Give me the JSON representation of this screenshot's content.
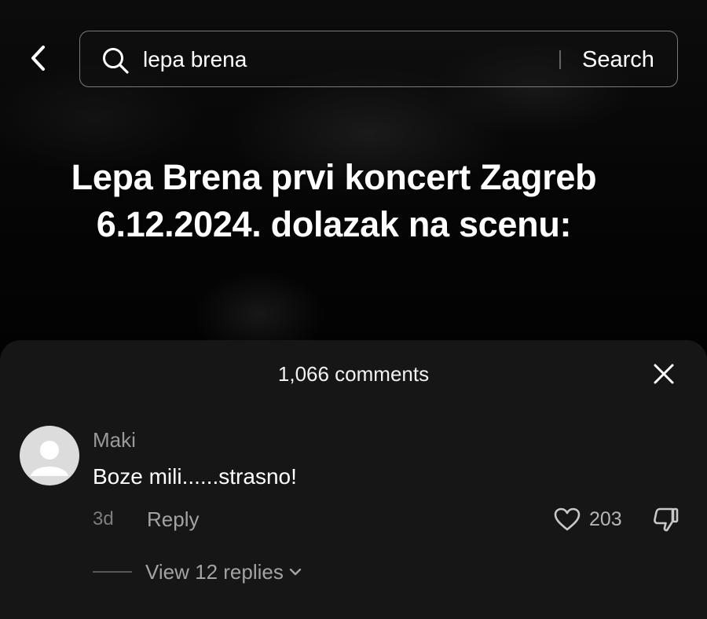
{
  "header": {
    "search": {
      "value": "lepa brena",
      "button_label": "Search"
    }
  },
  "video": {
    "caption_line1": "Lepa Brena prvi koncert Zagreb",
    "caption_line2": "6.12.2024. dolazak na scenu:"
  },
  "comments": {
    "count_label": "1,066 comments",
    "items": [
      {
        "username": "Maki",
        "text": "Boze mili......strasno!",
        "time": "3d",
        "reply_label": "Reply",
        "likes": "203",
        "view_replies_label": "View 12 replies"
      }
    ]
  },
  "icons": {
    "back": "chevron-left-icon",
    "search": "search-icon",
    "close": "close-icon",
    "like": "heart-icon",
    "dislike": "thumbs-down-icon",
    "expand": "chevron-down-icon",
    "avatar": "default-avatar-icon"
  },
  "colors": {
    "background": "#000000",
    "sheet": "#161616",
    "text_primary": "#ffffff",
    "text_secondary": "#9a9a9a",
    "avatar_bg": "#dcdcdc"
  }
}
